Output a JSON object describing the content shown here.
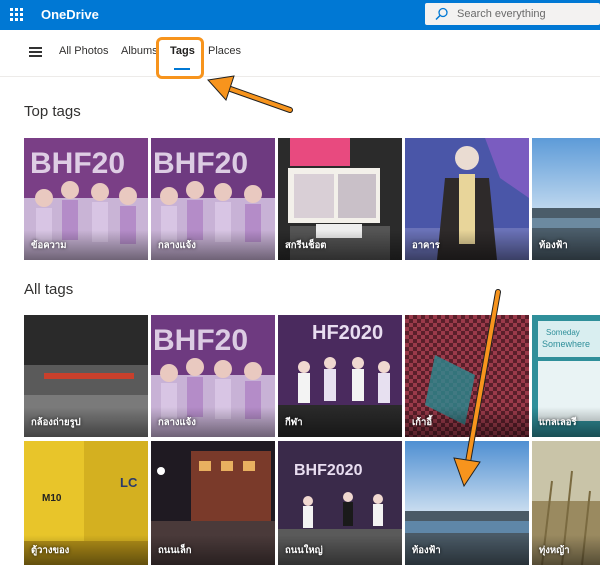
{
  "app": {
    "name": "OneDrive"
  },
  "search": {
    "placeholder": "Search everything"
  },
  "nav": {
    "tabs": [
      {
        "label": "All Photos"
      },
      {
        "label": "Albums"
      },
      {
        "label": "Tags",
        "active": true
      },
      {
        "label": "Places"
      }
    ]
  },
  "sections": {
    "top_tags": {
      "title": "Top tags"
    },
    "all_tags": {
      "title": "All tags"
    }
  },
  "top_tags": [
    {
      "label": "ข้อความ",
      "icon": "photo-concert-stage"
    },
    {
      "label": "กลางแจ้ง",
      "icon": "photo-concert-stage"
    },
    {
      "label": "สกรีนช็อต",
      "icon": "photo-screenshot"
    },
    {
      "label": "อาคาร",
      "icon": "photo-person-coat"
    },
    {
      "label": "ท้องฟ้า",
      "icon": "photo-aerial-city"
    }
  ],
  "all_tags": [
    {
      "label": "กล้องถ่ายรูป",
      "icon": "photo-laptop"
    },
    {
      "label": "กลางแจ้ง",
      "icon": "photo-concert-stage"
    },
    {
      "label": "กีฬา",
      "icon": "photo-performance"
    },
    {
      "label": "เก้าอี้",
      "icon": "photo-chair"
    },
    {
      "label": "แกลเลอรี",
      "icon": "photo-gallery"
    },
    {
      "label": "ตู้วางของ",
      "icon": "photo-yellow-truck"
    },
    {
      "label": "ถนนเล็ก",
      "icon": "photo-night-street"
    },
    {
      "label": "ถนนใหญ่",
      "icon": "photo-stage-dancers"
    },
    {
      "label": "ท้องฟ้า",
      "icon": "photo-aerial-city"
    },
    {
      "label": "ทุ่งหญ้า",
      "icon": "photo-grass"
    }
  ],
  "colors": {
    "accent": "#0078d4",
    "highlight": "#f7941d"
  }
}
